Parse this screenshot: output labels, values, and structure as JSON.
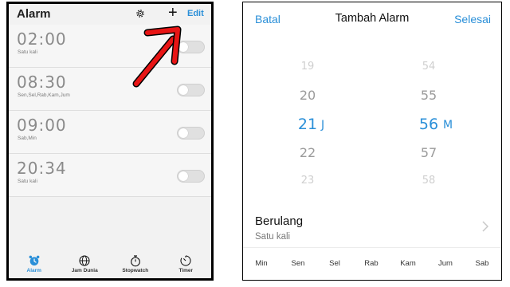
{
  "alarm_screen": {
    "title": "Alarm",
    "settings_icon": "gear-icon",
    "add_icon": "plus-icon",
    "add_symbol": "+",
    "edit_label": "Edit",
    "alarms": [
      {
        "time": "02:00",
        "repeat": "Satu kali",
        "enabled": false
      },
      {
        "time": "08:30",
        "repeat": "Sen,Sel,Rab,Kam,Jum",
        "enabled": false
      },
      {
        "time": "09:00",
        "repeat": "Sab,Min",
        "enabled": false
      },
      {
        "time": "20:34",
        "repeat": "Satu kali",
        "enabled": false
      }
    ],
    "nav": [
      {
        "label": "Alarm",
        "icon": "alarm-clock-icon",
        "active": true
      },
      {
        "label": "Jam Dunia",
        "icon": "globe-icon",
        "active": false
      },
      {
        "label": "Stopwatch",
        "icon": "stopwatch-icon",
        "active": false
      },
      {
        "label": "Timer",
        "icon": "timer-icon",
        "active": false
      }
    ],
    "annotation": {
      "icon": "red-arrow-icon",
      "color": "#e81515"
    }
  },
  "add_alarm_screen": {
    "cancel_label": "Batal",
    "title": "Tambah Alarm",
    "done_label": "Selesai",
    "hour_picker": {
      "values": [
        "19",
        "20",
        "21",
        "22",
        "23"
      ],
      "selected": "21",
      "unit": "J"
    },
    "minute_picker": {
      "values": [
        "54",
        "55",
        "56",
        "57",
        "58"
      ],
      "selected": "56",
      "unit": "M"
    },
    "repeat": {
      "title": "Berulang",
      "value": "Satu kali",
      "chevron_icon": "chevron-right-icon"
    },
    "days": [
      "Min",
      "Sen",
      "Sel",
      "Rab",
      "Kam",
      "Jum",
      "Sab"
    ]
  },
  "colors": {
    "accent": "#2a8fd8",
    "arrow": "#e81515"
  }
}
